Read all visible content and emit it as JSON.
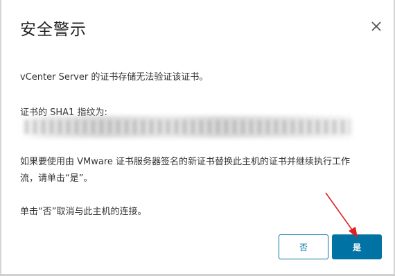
{
  "dialog": {
    "title": "安全警示",
    "close_icon": "close-icon",
    "messages": {
      "line1": "vCenter Server 的证书存储无法验证该证书。",
      "line2": "证书的 SHA1 指纹为:",
      "line4a": "如果要使用由 VMware 证书服务器签名的新证书替换此主机的证书并继续执行工作",
      "line4b": "流，请单击“是”。",
      "line5": "单击“否”取消与此主机的连接。"
    },
    "buttons": {
      "no_label": "否",
      "yes_label": "是"
    }
  },
  "colors": {
    "accent": "#0072a3",
    "annotation_arrow": "#e02020"
  }
}
